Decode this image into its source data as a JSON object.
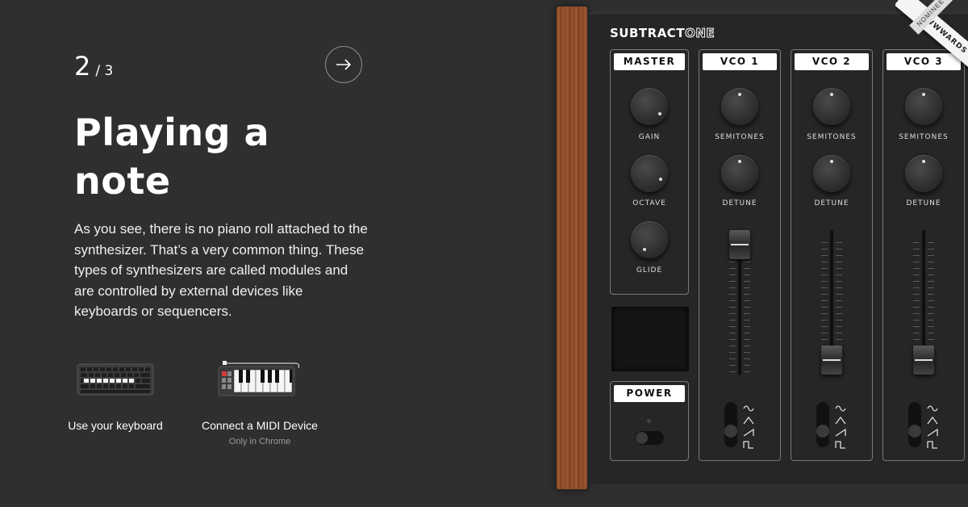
{
  "tutorial": {
    "step_current": "2",
    "step_total": "/ 3",
    "title": "Playing a note",
    "description": "As you see, there is no piano roll attached to the synthesizer. That’s a very common thing. These types of synthesizers are called modules and are controlled by external devices like keyboards or sequencers.",
    "next_icon": "arrow-right-icon"
  },
  "options": {
    "keyboard": {
      "label": "Use your keyboard",
      "icon": "keyboard-icon"
    },
    "midi": {
      "label": "Connect a MIDI Device",
      "sublabel": "Only in Chrome",
      "icon": "midi-keyboard-icon"
    }
  },
  "synth": {
    "brand_part1": "SUBTRACT",
    "brand_part2": "ONE",
    "master": {
      "title": "MASTER",
      "knobs": [
        "GAIN",
        "OCTAVE",
        "GLIDE"
      ]
    },
    "vcos": [
      {
        "title": "VCO 1",
        "knobs": [
          "SEMITONES",
          "DETUNE"
        ],
        "fader_level": 1.0
      },
      {
        "title": "VCO 2",
        "knobs": [
          "SEMITONES",
          "DETUNE"
        ],
        "fader_level": 0.05
      },
      {
        "title": "VCO 3",
        "knobs": [
          "SEMITONES",
          "DETUNE"
        ],
        "fader_level": 0.05
      }
    ],
    "power": {
      "title": "POWER",
      "on": false
    },
    "waveforms": [
      "sine-wave-icon",
      "triangle-wave-icon",
      "sawtooth-wave-icon",
      "square-wave-icon"
    ]
  },
  "award": {
    "badge": "NOMINEE",
    "site": "AWWWARDS"
  },
  "colors": {
    "background": "#2f2f2f",
    "panel": "#262626",
    "wood": "#8b4a2a"
  }
}
